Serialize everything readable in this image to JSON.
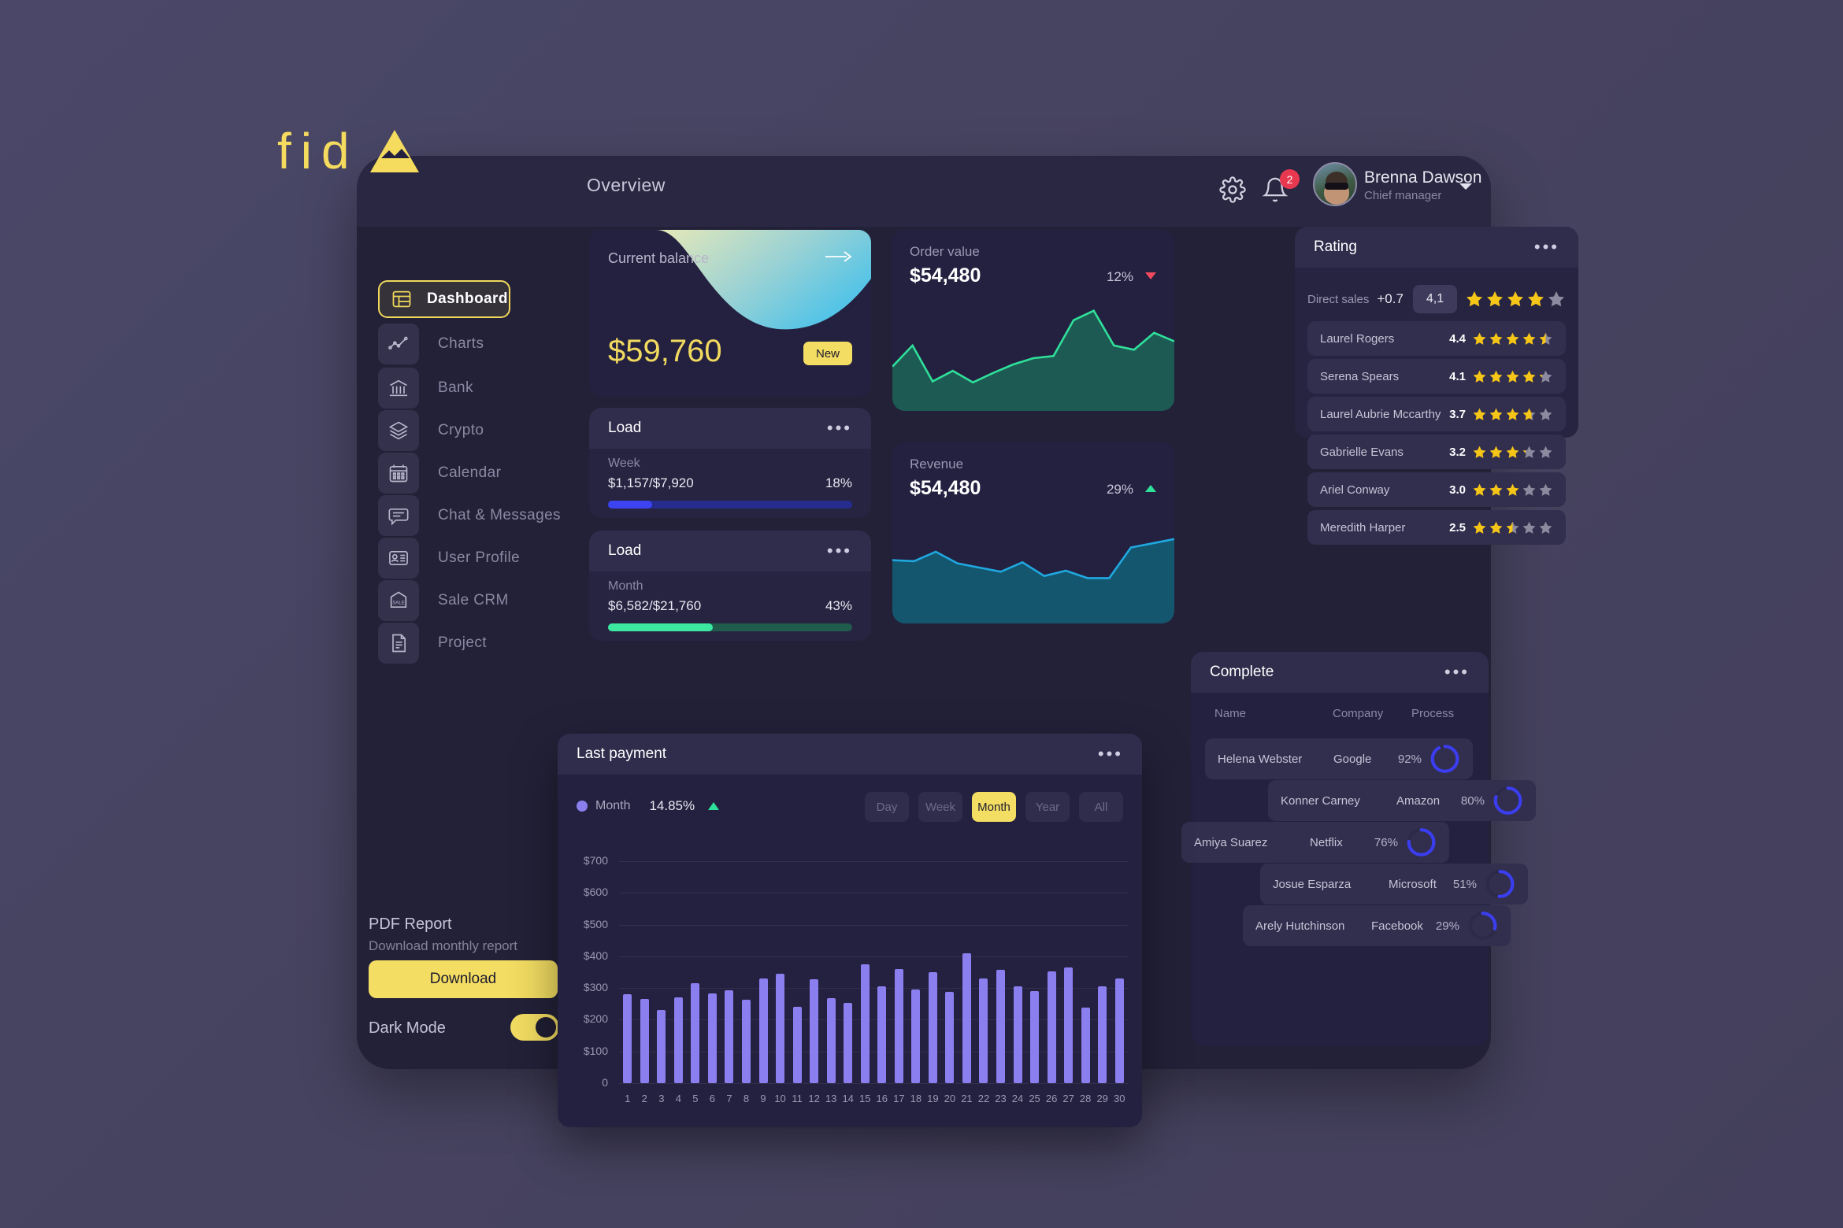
{
  "brand": {
    "text": "fid",
    "mark": "mountain-icon",
    "color": "#f5dc5e"
  },
  "header": {
    "title": "Overview",
    "gear_icon": "gear-icon",
    "bell_icon": "bell-icon",
    "notification_count": "2",
    "user": {
      "name": "Brenna Dawson",
      "role": "Chief manager"
    },
    "caret_icon": "chevron-down-icon"
  },
  "sidebar": {
    "items": [
      {
        "label": "Dashboard",
        "icon": "dashboard-icon",
        "active": true
      },
      {
        "label": "Charts",
        "icon": "chart-line-icon",
        "active": false
      },
      {
        "label": "Bank",
        "icon": "bank-icon",
        "active": false
      },
      {
        "label": "Crypto",
        "icon": "layers-icon",
        "active": false
      },
      {
        "label": "Calendar",
        "icon": "calendar-icon",
        "active": false
      },
      {
        "label": "Chat & Messages",
        "icon": "chat-icon",
        "active": false
      },
      {
        "label": "User Profile",
        "icon": "id-card-icon",
        "active": false
      },
      {
        "label": "Sale CRM",
        "icon": "sale-tag-icon",
        "active": false
      },
      {
        "label": "Project",
        "icon": "document-icon",
        "active": false
      }
    ],
    "pdf": {
      "title": "PDF Report",
      "subtitle": "Download monthly report",
      "button": "Download"
    },
    "dark_mode": {
      "label": "Dark Mode",
      "on": true
    }
  },
  "balance": {
    "label": "Current balance",
    "amount": "$59,760",
    "badge": "New",
    "arrow_icon": "arrow-right-icon"
  },
  "load": [
    {
      "title": "Load",
      "period": "Week",
      "value": "$1,157/$7,920",
      "percent": "18%",
      "fill": 18,
      "color": "#3b44f0",
      "track": "#262b8e"
    },
    {
      "title": "Load",
      "period": "Month",
      "value": "$6,582/$21,760",
      "percent": "43%",
      "fill": 43,
      "color": "#3ce8a0",
      "track": "#1f5c4c"
    }
  ],
  "mini_charts": [
    {
      "title": "Order value",
      "value": "$54,480",
      "percent": "12%",
      "trend": "down",
      "trend_color": "#ef4a5d",
      "line": "#2fe09a",
      "fill": "#1d5a53",
      "key": "order_value"
    },
    {
      "title": "Revenue",
      "value": "$54,480",
      "percent": "29%",
      "trend": "up",
      "trend_color": "#2fe09a",
      "line": "#1fa8e0",
      "fill": "#15566f",
      "key": "revenue"
    }
  ],
  "rating": {
    "title": "Rating",
    "summary": {
      "label": "Direct sales",
      "delta": "+0.7",
      "chip": "4,1",
      "stars": 4.0
    },
    "rows": [
      {
        "name": "Laurel Rogers",
        "score": "4.4",
        "stars": 4.5
      },
      {
        "name": "Serena Spears",
        "score": "4.1",
        "stars": 4.2
      },
      {
        "name": "Laurel Aubrie Mccarthy",
        "score": "3.7",
        "stars": 3.7
      },
      {
        "name": "Gabrielle Evans",
        "score": "3.2",
        "stars": 3.2
      },
      {
        "name": "Ariel Conway",
        "score": "3.0",
        "stars": 3.0
      },
      {
        "name": "Meredith Harper",
        "score": "2.5",
        "stars": 2.5
      }
    ]
  },
  "complete": {
    "title": "Complete",
    "columns": [
      "Name",
      "Company",
      "Process"
    ],
    "rows": [
      {
        "name": "Helena Webster",
        "company": "Google",
        "percent": "92%",
        "value": 92,
        "offset": 0
      },
      {
        "name": "Konner Carney",
        "company": "Amazon",
        "percent": "80%",
        "value": 80,
        "offset": 80
      },
      {
        "name": "Amiya Suarez",
        "company": "Netflix",
        "percent": "76%",
        "value": 76,
        "offset": -30
      },
      {
        "name": "Josue Esparza",
        "company": "Microsoft",
        "percent": "51%",
        "value": 51,
        "offset": 70
      },
      {
        "name": "Arely Hutchinson",
        "company": "Facebook",
        "percent": "29%",
        "value": 29,
        "offset": 48
      }
    ],
    "ring_color": "#3b3ef0"
  },
  "last_payment": {
    "title": "Last payment",
    "legend_label": "Month",
    "legend_value": "14.85%",
    "legend_trend": "up",
    "tabs": [
      {
        "label": "Day",
        "active": false
      },
      {
        "label": "Week",
        "active": false
      },
      {
        "label": "Month",
        "active": true
      },
      {
        "label": "Year",
        "active": false
      },
      {
        "label": "All",
        "active": false
      }
    ]
  },
  "chart_data": [
    {
      "type": "bar",
      "title": "Last payment",
      "xlabel": "",
      "ylabel": "",
      "ylim": [
        0,
        700
      ],
      "ytick_labels": [
        "0",
        "$100",
        "$200",
        "$300",
        "$400",
        "$500",
        "$600",
        "$700"
      ],
      "yticks": [
        0,
        100,
        200,
        300,
        400,
        500,
        600,
        700
      ],
      "grid": true,
      "bar_color": "#8b7ff0",
      "categories": [
        "1",
        "2",
        "3",
        "4",
        "5",
        "6",
        "7",
        "8",
        "9",
        "10",
        "11",
        "12",
        "13",
        "14",
        "15",
        "16",
        "17",
        "18",
        "19",
        "20",
        "21",
        "22",
        "23",
        "24",
        "25",
        "26",
        "27",
        "28",
        "29",
        "30"
      ],
      "values": [
        280,
        265,
        230,
        270,
        315,
        282,
        293,
        262,
        330,
        345,
        240,
        328,
        268,
        252,
        375,
        305,
        360,
        295,
        350,
        288,
        410,
        330,
        358,
        305,
        290,
        352,
        365,
        238,
        305,
        330
      ]
    },
    {
      "type": "area",
      "title": "Order value",
      "ylim": [
        0,
        100
      ],
      "grid": false,
      "line_color": "#2fe09a",
      "fill_color": "#1d5a53",
      "x": [
        0,
        1,
        2,
        3,
        4,
        5,
        6,
        7,
        8,
        9,
        10,
        11,
        12,
        13,
        14
      ],
      "values": [
        42,
        62,
        28,
        38,
        27,
        36,
        44,
        50,
        52,
        86,
        95,
        62,
        58,
        74,
        66
      ]
    },
    {
      "type": "area",
      "title": "Revenue",
      "ylim": [
        0,
        100
      ],
      "grid": false,
      "line_color": "#1fa8e0",
      "fill_color": "#15566f",
      "x": [
        0,
        1,
        2,
        3,
        4,
        5,
        6,
        7,
        8,
        9,
        10,
        11,
        12,
        13
      ],
      "values": [
        60,
        59,
        68,
        57,
        53,
        49,
        58,
        45,
        50,
        43,
        43,
        72,
        76,
        80
      ]
    }
  ]
}
